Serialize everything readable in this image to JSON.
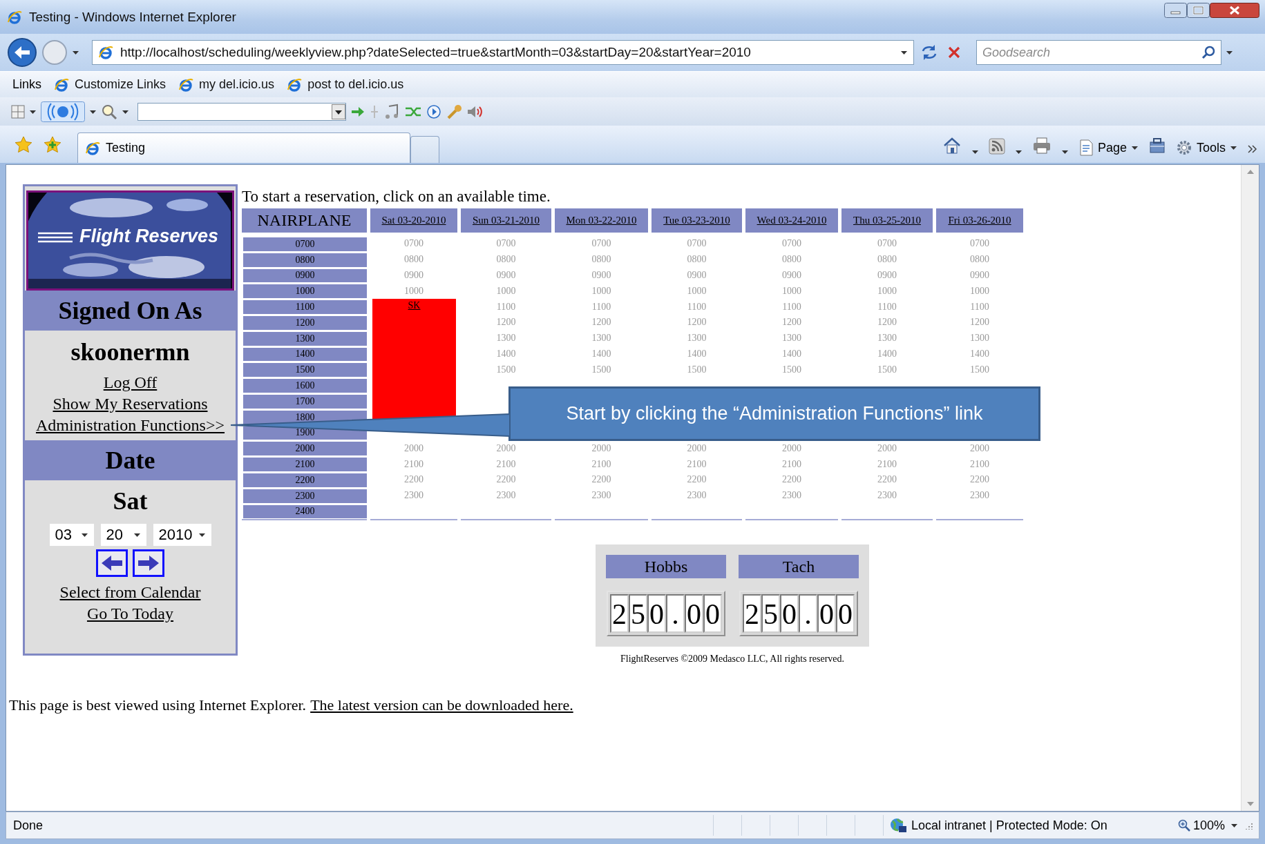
{
  "window": {
    "title": "Testing - Windows Internet Explorer"
  },
  "address_bar": {
    "url": "http://localhost/scheduling/weeklyview.php?dateSelected=true&startMonth=03&startDay=20&startYear=2010",
    "search_placeholder": "Goodsearch"
  },
  "links_bar": {
    "label": "Links",
    "links": [
      "Customize Links",
      "my del.icio.us",
      "post to del.icio.us"
    ]
  },
  "tabs": [
    {
      "label": "Testing",
      "selected": true
    }
  ],
  "command_bar": [
    "Page",
    "Tools"
  ],
  "sidebar": {
    "logo_text": "Flight Reserves",
    "signed_on_heading": "Signed On As",
    "username": "skoonermn",
    "user_links": [
      "Log Off",
      "Show My Reservations",
      "Administration Functions>>"
    ],
    "date_heading": "Date",
    "weekday": "Sat",
    "date_selects": [
      "03",
      "20",
      "2010"
    ],
    "calendar_links": [
      "Select from Calendar",
      "Go To Today"
    ]
  },
  "intro": "To start a reservation, click on an available time.",
  "schedule": {
    "aircraft": "NAIRPLANE",
    "times": [
      "0700",
      "0800",
      "0900",
      "1000",
      "1100",
      "1200",
      "1300",
      "1400",
      "1500",
      "1600",
      "1700",
      "1800",
      "1900",
      "2000",
      "2100",
      "2200",
      "2300",
      "2400"
    ],
    "days": [
      {
        "label": "Sat 03-20-2010",
        "slots": [
          {
            "kind": "free",
            "text": "0700"
          },
          {
            "kind": "free",
            "text": "0800"
          },
          {
            "kind": "free",
            "text": "0900"
          },
          {
            "kind": "free",
            "text": "1000"
          },
          {
            "kind": "booked",
            "label": "SK"
          },
          {
            "kind": "booked"
          },
          {
            "kind": "booked"
          },
          {
            "kind": "booked"
          },
          {
            "kind": "booked"
          },
          {
            "kind": "booked"
          },
          {
            "kind": "booked"
          },
          {
            "kind": "booked"
          },
          {
            "kind": "empty"
          },
          {
            "kind": "free",
            "text": "2000"
          },
          {
            "kind": "free",
            "text": "2100"
          },
          {
            "kind": "free",
            "text": "2200"
          },
          {
            "kind": "free",
            "text": "2300"
          },
          {
            "kind": "empty"
          }
        ]
      },
      {
        "label": "Sun 03-21-2010",
        "slots": [
          {
            "kind": "free",
            "text": "0700"
          },
          {
            "kind": "free",
            "text": "0800"
          },
          {
            "kind": "free",
            "text": "0900"
          },
          {
            "kind": "free",
            "text": "1000"
          },
          {
            "kind": "free",
            "text": "1100"
          },
          {
            "kind": "free",
            "text": "1200"
          },
          {
            "kind": "free",
            "text": "1300"
          },
          {
            "kind": "free",
            "text": "1400"
          },
          {
            "kind": "free",
            "text": "1500"
          },
          {
            "kind": "empty"
          },
          {
            "kind": "empty"
          },
          {
            "kind": "empty"
          },
          {
            "kind": "empty"
          },
          {
            "kind": "free",
            "text": "2000"
          },
          {
            "kind": "free",
            "text": "2100"
          },
          {
            "kind": "free",
            "text": "2200"
          },
          {
            "kind": "free",
            "text": "2300"
          },
          {
            "kind": "empty"
          }
        ]
      },
      {
        "label": "Mon 03-22-2010",
        "slots": [
          {
            "kind": "free",
            "text": "0700"
          },
          {
            "kind": "free",
            "text": "0800"
          },
          {
            "kind": "free",
            "text": "0900"
          },
          {
            "kind": "free",
            "text": "1000"
          },
          {
            "kind": "free",
            "text": "1100"
          },
          {
            "kind": "free",
            "text": "1200"
          },
          {
            "kind": "free",
            "text": "1300"
          },
          {
            "kind": "free",
            "text": "1400"
          },
          {
            "kind": "free",
            "text": "1500"
          },
          {
            "kind": "empty"
          },
          {
            "kind": "empty"
          },
          {
            "kind": "empty"
          },
          {
            "kind": "empty"
          },
          {
            "kind": "free",
            "text": "2000"
          },
          {
            "kind": "free",
            "text": "2100"
          },
          {
            "kind": "free",
            "text": "2200"
          },
          {
            "kind": "free",
            "text": "2300"
          },
          {
            "kind": "empty"
          }
        ]
      },
      {
        "label": "Tue 03-23-2010",
        "slots": [
          {
            "kind": "free",
            "text": "0700"
          },
          {
            "kind": "free",
            "text": "0800"
          },
          {
            "kind": "free",
            "text": "0900"
          },
          {
            "kind": "free",
            "text": "1000"
          },
          {
            "kind": "free",
            "text": "1100"
          },
          {
            "kind": "free",
            "text": "1200"
          },
          {
            "kind": "free",
            "text": "1300"
          },
          {
            "kind": "free",
            "text": "1400"
          },
          {
            "kind": "free",
            "text": "1500"
          },
          {
            "kind": "empty"
          },
          {
            "kind": "empty"
          },
          {
            "kind": "empty"
          },
          {
            "kind": "empty"
          },
          {
            "kind": "free",
            "text": "2000"
          },
          {
            "kind": "free",
            "text": "2100"
          },
          {
            "kind": "free",
            "text": "2200"
          },
          {
            "kind": "free",
            "text": "2300"
          },
          {
            "kind": "empty"
          }
        ]
      },
      {
        "label": "Wed 03-24-2010",
        "slots": [
          {
            "kind": "free",
            "text": "0700"
          },
          {
            "kind": "free",
            "text": "0800"
          },
          {
            "kind": "free",
            "text": "0900"
          },
          {
            "kind": "free",
            "text": "1000"
          },
          {
            "kind": "free",
            "text": "1100"
          },
          {
            "kind": "free",
            "text": "1200"
          },
          {
            "kind": "free",
            "text": "1300"
          },
          {
            "kind": "free",
            "text": "1400"
          },
          {
            "kind": "free",
            "text": "1500"
          },
          {
            "kind": "empty"
          },
          {
            "kind": "empty"
          },
          {
            "kind": "empty"
          },
          {
            "kind": "empty"
          },
          {
            "kind": "free",
            "text": "2000"
          },
          {
            "kind": "free",
            "text": "2100"
          },
          {
            "kind": "free",
            "text": "2200"
          },
          {
            "kind": "free",
            "text": "2300"
          },
          {
            "kind": "empty"
          }
        ]
      },
      {
        "label": "Thu 03-25-2010",
        "slots": [
          {
            "kind": "free",
            "text": "0700"
          },
          {
            "kind": "free",
            "text": "0800"
          },
          {
            "kind": "free",
            "text": "0900"
          },
          {
            "kind": "free",
            "text": "1000"
          },
          {
            "kind": "free",
            "text": "1100"
          },
          {
            "kind": "free",
            "text": "1200"
          },
          {
            "kind": "free",
            "text": "1300"
          },
          {
            "kind": "free",
            "text": "1400"
          },
          {
            "kind": "free",
            "text": "1500"
          },
          {
            "kind": "empty"
          },
          {
            "kind": "empty"
          },
          {
            "kind": "empty"
          },
          {
            "kind": "empty"
          },
          {
            "kind": "free",
            "text": "2000"
          },
          {
            "kind": "free",
            "text": "2100"
          },
          {
            "kind": "free",
            "text": "2200"
          },
          {
            "kind": "free",
            "text": "2300"
          },
          {
            "kind": "empty"
          }
        ]
      },
      {
        "label": "Fri 03-26-2010",
        "slots": [
          {
            "kind": "free",
            "text": "0700"
          },
          {
            "kind": "free",
            "text": "0800"
          },
          {
            "kind": "free",
            "text": "0900"
          },
          {
            "kind": "free",
            "text": "1000"
          },
          {
            "kind": "free",
            "text": "1100"
          },
          {
            "kind": "free",
            "text": "1200"
          },
          {
            "kind": "free",
            "text": "1300"
          },
          {
            "kind": "free",
            "text": "1400"
          },
          {
            "kind": "free",
            "text": "1500"
          },
          {
            "kind": "empty"
          },
          {
            "kind": "empty"
          },
          {
            "kind": "empty"
          },
          {
            "kind": "empty"
          },
          {
            "kind": "free",
            "text": "2000"
          },
          {
            "kind": "free",
            "text": "2100"
          },
          {
            "kind": "free",
            "text": "2200"
          },
          {
            "kind": "free",
            "text": "2300"
          },
          {
            "kind": "empty"
          }
        ]
      }
    ]
  },
  "meters": [
    {
      "label": "Hobbs",
      "digits": [
        "2",
        "5",
        "0",
        ".",
        "0",
        "0"
      ]
    },
    {
      "label": "Tach",
      "digits": [
        "2",
        "5",
        "0",
        ".",
        "0",
        "0"
      ]
    }
  ],
  "copyright": "FlightReserves ©2009 Medasco LLC, All rights reserved.",
  "footer": {
    "text": "This page is best viewed using Internet Explorer.",
    "link": "The latest version can be downloaded here."
  },
  "callout": {
    "text": "Start by clicking the “Administration Functions” link"
  },
  "status_bar": {
    "status": "Done",
    "zone": "Local intranet | Protected Mode: On",
    "zoom": "100%"
  }
}
